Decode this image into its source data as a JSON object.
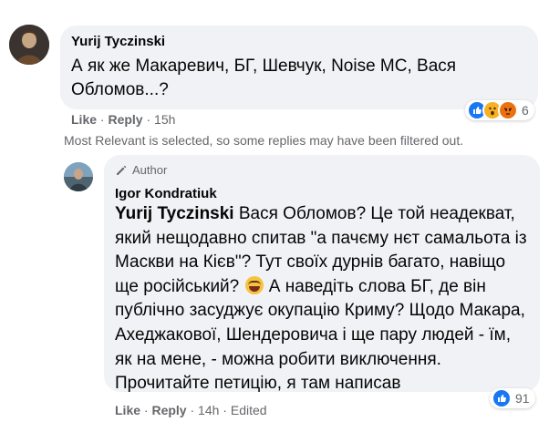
{
  "comment": {
    "author": "Yurij Tyczinski",
    "text": "А як же Макаревич, БГ, Шевчук, Noise MC, Вася Обломов...?",
    "reactions": {
      "icons": [
        "like-icon",
        "wow-icon",
        "angry-icon"
      ],
      "count": "6"
    },
    "actions": {
      "like": "Like",
      "reply": "Reply",
      "separator": "·",
      "time": "15h"
    }
  },
  "filter_note": "Most Relevant is selected, so some replies may have been filtered out.",
  "reply": {
    "badge": "Author",
    "author": "Igor Kondratiuk",
    "mention": "Yurij Tyczinski",
    "text_before_emoji": " Вася Обломов? Це той неадекват, який нещодавно спитав \"а пачєму нєт самальота із Маскви на Кієв\"? Тут своїх дурнів багато, навіщо ще російський?",
    "text_after_emoji": " А наведіть слова БГ, де він публічно засуджує окупацію Криму? Щодо Макара, Ахеджакової, Шендеровича і ще пару людей - їм, як на мене, - можна робити виключення. Прочитайте петицію, я там написав",
    "reactions": {
      "icons": [
        "like-icon"
      ],
      "count": "91"
    },
    "actions": {
      "like": "Like",
      "reply": "Reply",
      "separator": "·",
      "time": "14h",
      "edited": "Edited"
    }
  },
  "colors": {
    "bubble": "#f0f2f5",
    "meta_text": "#65676b",
    "like_blue": "#1877f2"
  }
}
